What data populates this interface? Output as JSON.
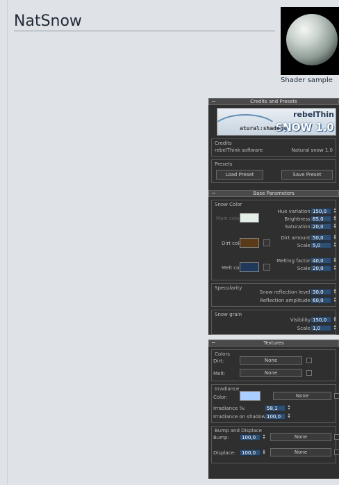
{
  "page": {
    "title": "NatSnow"
  },
  "sample": {
    "caption": "Shader sample"
  },
  "credits": {
    "header": "Credits and Presets",
    "logo": {
      "brand": "rebelThin",
      "product": "SNOW 1.0",
      "line": "atural:shaders"
    },
    "credits_label": "Credits",
    "author": "rebelThink software",
    "version": "Natural snow 1.0",
    "presets_label": "Presets",
    "load_label": "Load Preset",
    "save_label": "Save Preset"
  },
  "base": {
    "header": "Base Parameters",
    "snow_color_label": "Snow Color",
    "main_color_label": "Main color",
    "main_color": "#e4ede6",
    "hue_label": "Hue variation:",
    "hue_value": "150,0",
    "brightness_label": "Brightness:",
    "brightness_value": "85,0",
    "saturation_label": "Saturation:",
    "saturation_value": "20,0",
    "dirt_color_label": "Dirt color:",
    "dirt_color": "#5a3a17",
    "dirt_amount_label": "Dirt amount:",
    "dirt_amount_value": "50,0",
    "dirt_scale_label": "Scale:",
    "dirt_scale_value": "5,0",
    "melt_color_label": "Melt color:",
    "melt_color": "#20395a",
    "melting_label": "Melting factor:",
    "melting_value": "40,0",
    "melt_scale_label": "Scale:",
    "melt_scale_value": "20,0",
    "specularity_label": "Specularity",
    "snow_refl_label": "Snow reflection level:",
    "snow_refl_value": "30,0",
    "refl_amp_label": "Reflection amplitude:",
    "refl_amp_value": "60,0",
    "grain_label": "Snow grain",
    "visibility_label": "Visibility:",
    "visibility_value": "150,0",
    "grain_scale_label": "Scale:",
    "grain_scale_value": "1,0"
  },
  "textures": {
    "header": "Textures",
    "colors_label": "Colors",
    "dirt_label": "Dirt:",
    "dirt_map": "None",
    "melt_label": "Melt:",
    "melt_map": "None",
    "irradiance_label": "Irradiance",
    "color_label": "Color:",
    "irr_color": "#a9ceff",
    "irr_map": "None",
    "irr_pct_label": "Irradiance %:",
    "irr_pct_value": "58,1",
    "irr_shadow_label": "Irradiance on shadow:",
    "irr_shadow_value": "100,0",
    "bump_group_label": "Bump and Displace",
    "bump_label": "Bump:",
    "bump_value": "100,0",
    "bump_map": "None",
    "displace_label": "Displace:",
    "displace_value": "100,0",
    "displace_map": "None"
  }
}
